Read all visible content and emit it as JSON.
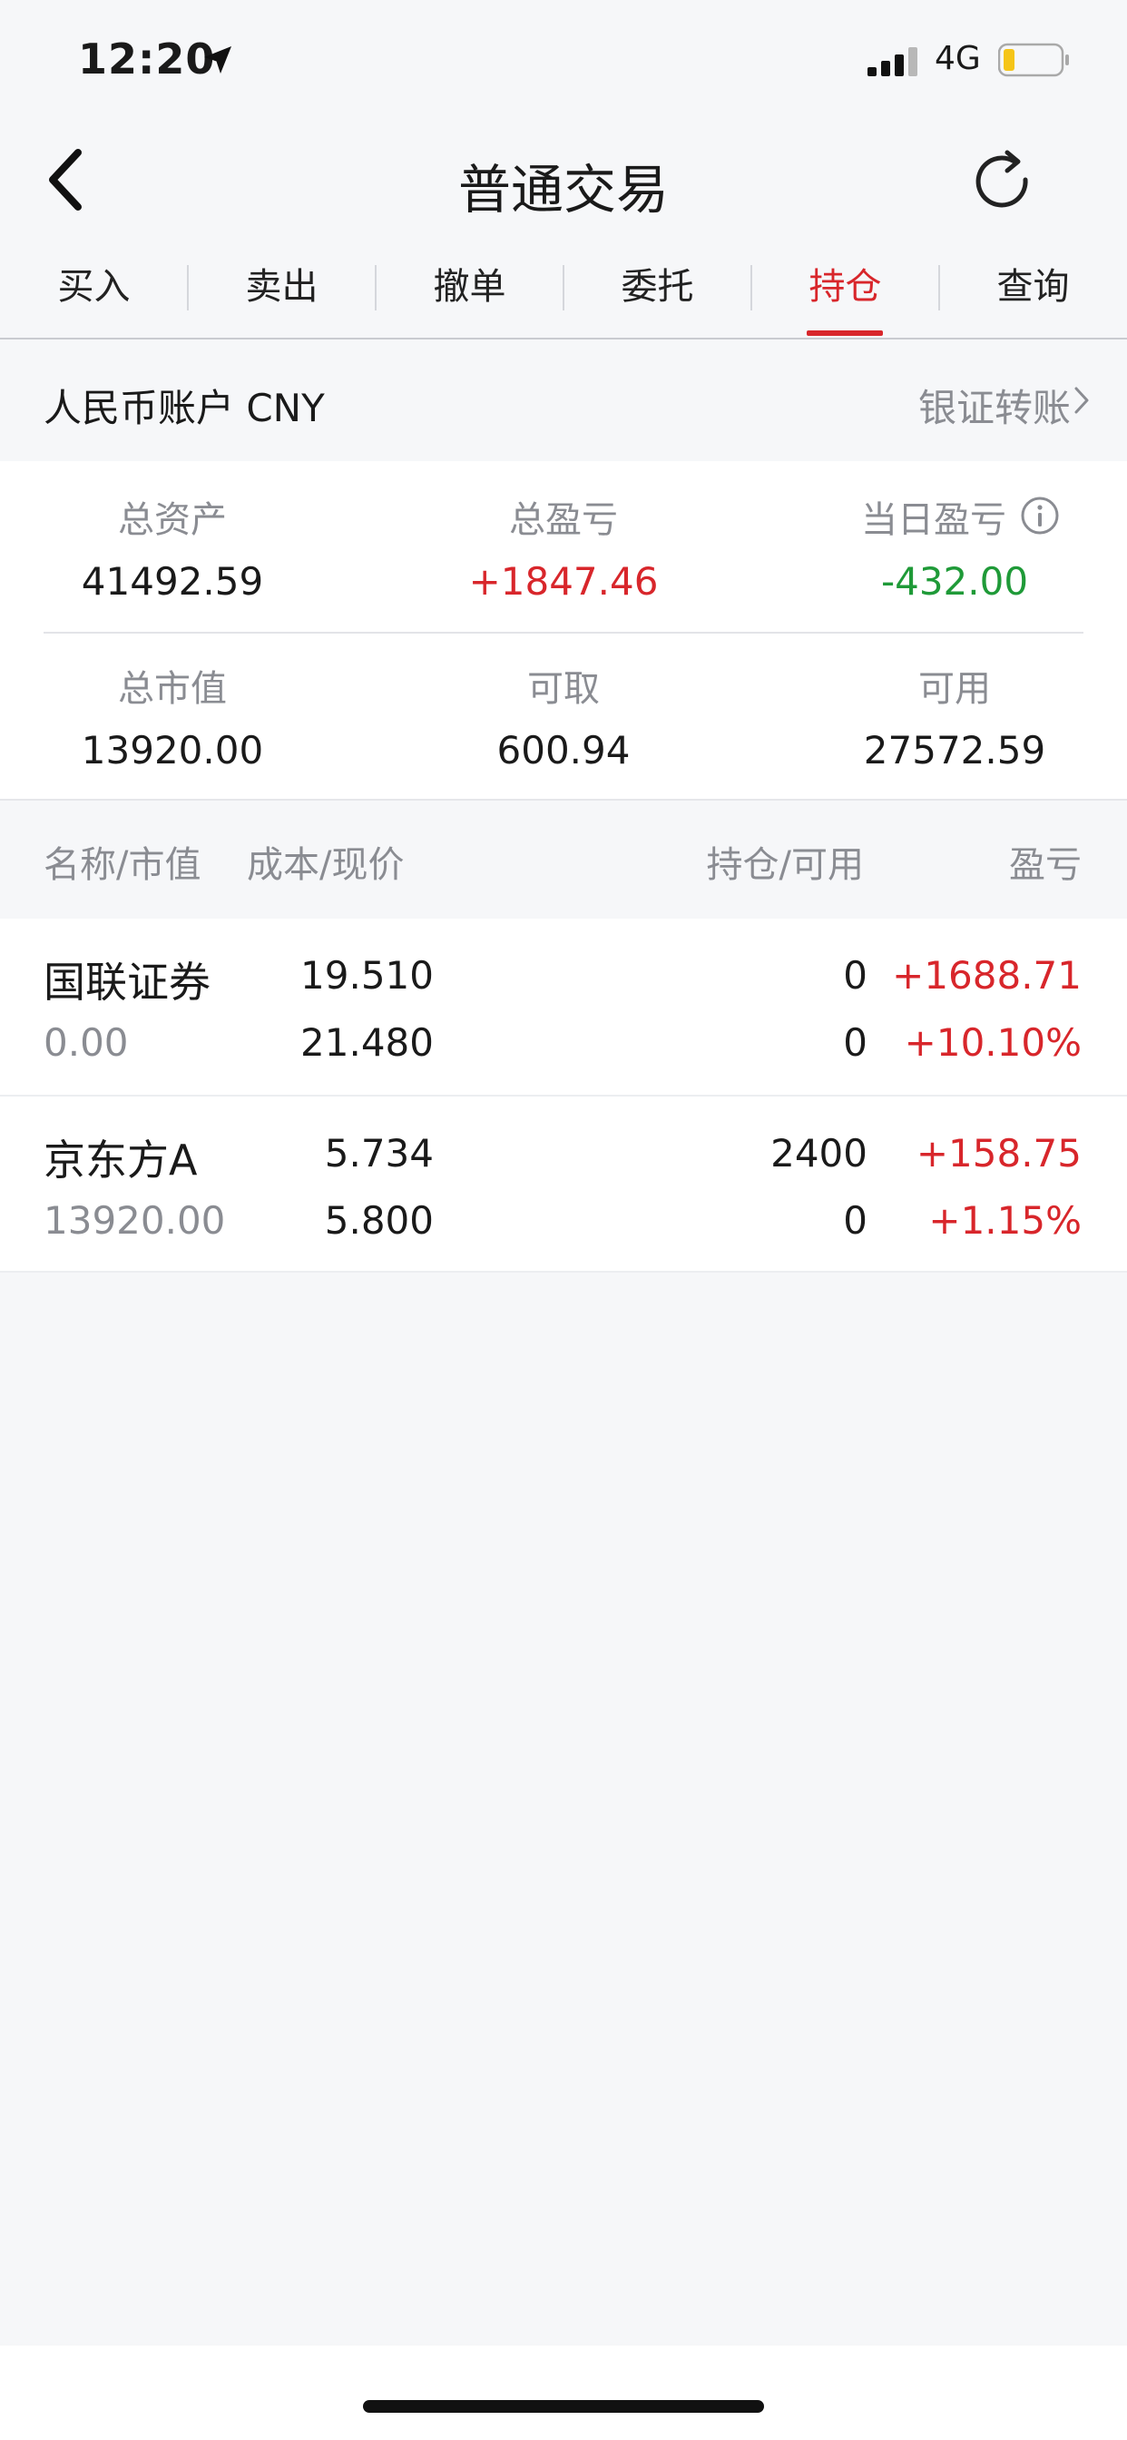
{
  "status_bar": {
    "time": "12:20",
    "network": "4G",
    "icons": [
      "location-arrow-icon",
      "signal-icon",
      "battery-icon"
    ]
  },
  "nav": {
    "title": "普通交易",
    "back_icon": "chevron-left-icon",
    "refresh_icon": "refresh-icon"
  },
  "tabs": [
    {
      "label": "买入"
    },
    {
      "label": "卖出"
    },
    {
      "label": "撤单"
    },
    {
      "label": "委托"
    },
    {
      "label": "持仓",
      "active": true
    },
    {
      "label": "查询"
    }
  ],
  "account": {
    "label": "人民币账户 CNY",
    "transfer_label": "银证转账"
  },
  "summary": {
    "total_assets_label": "总资产",
    "total_assets": "41492.59",
    "total_pl_label": "总盈亏",
    "total_pl": "+1847.46",
    "daily_pl_label": "当日盈亏",
    "daily_pl": "-432.00",
    "market_value_label": "总市值",
    "market_value": "13920.00",
    "withdrawable_label": "可取",
    "withdrawable": "600.94",
    "available_label": "可用",
    "available": "27572.59"
  },
  "table": {
    "headers": {
      "name_value": "名称/市值",
      "cost_price": "成本/现价",
      "position_available": "持仓/可用",
      "pl": "盈亏"
    },
    "rows": [
      {
        "name": "国联证券",
        "market_value": "0.00",
        "cost": "19.510",
        "price": "21.480",
        "position": "0",
        "available": "0",
        "pl": "+1688.71",
        "pl_pct": "+10.10%"
      },
      {
        "name": "京东方A",
        "market_value": "13920.00",
        "cost": "5.734",
        "price": "5.800",
        "position": "2400",
        "available": "0",
        "pl": "+158.75",
        "pl_pct": "+1.15%"
      }
    ]
  },
  "colors": {
    "accent_red": "#d8262b",
    "loss_green": "#1f9a38",
    "muted_gray": "#8a8c92",
    "background": "#f6f7f9"
  }
}
